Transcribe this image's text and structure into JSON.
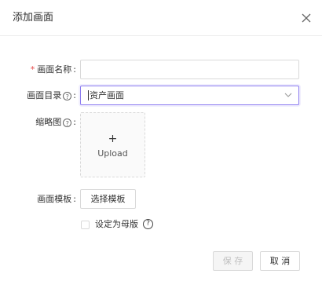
{
  "dialog": {
    "title": "添加画面",
    "close_icon": "close-icon"
  },
  "form": {
    "name_label": "画面名称",
    "name_value": "",
    "directory_label": "画面目录",
    "directory_value": "资产画面",
    "thumbnail_label": "缩略图",
    "upload_plus": "+",
    "upload_text": "Upload",
    "template_label": "画面模板",
    "template_button": "选择模板",
    "master_checkbox_label": "设定为母版",
    "colon": ":",
    "required_mark": "*",
    "help_glyph": "?"
  },
  "footer": {
    "save_label": "保 存",
    "cancel_label": "取 消"
  },
  "colors": {
    "accent": "#8c7cf0",
    "required": "#e64b4b",
    "border": "#d9d9d9"
  }
}
